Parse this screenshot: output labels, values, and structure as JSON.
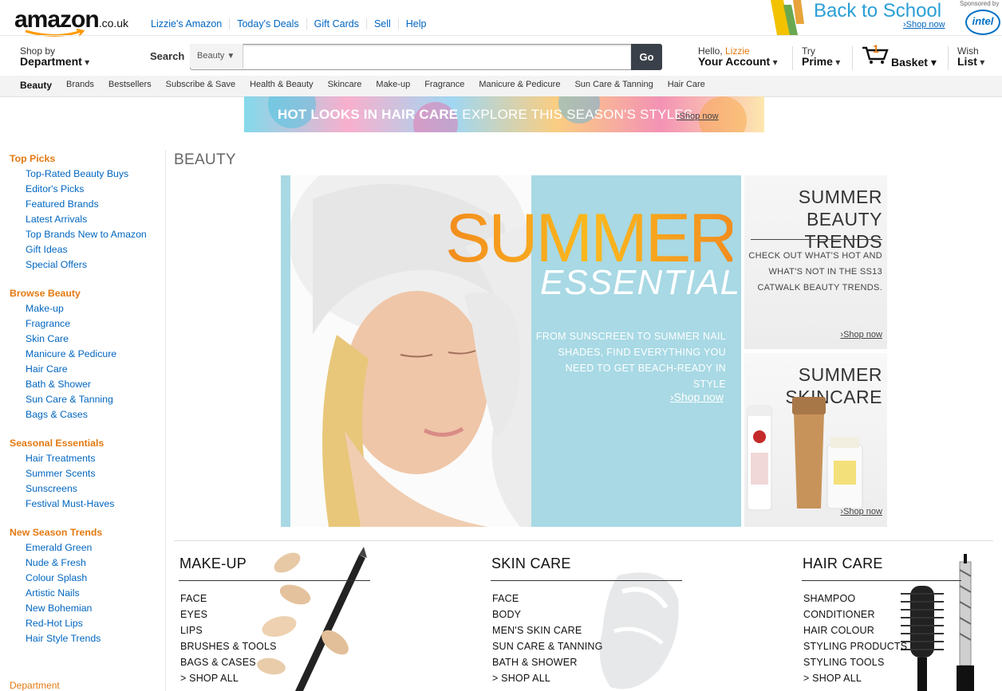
{
  "header": {
    "logo_text": "amazon",
    "logo_tld": ".co.uk",
    "top_links": [
      "Lizzie's Amazon",
      "Today's Deals",
      "Gift Cards",
      "Sell",
      "Help"
    ],
    "promo": {
      "title": "Back to School",
      "shop_now": "Shop now",
      "sponsored": "Sponsored by",
      "sponsor": "intel"
    },
    "shop_by": "Shop by",
    "department": "Department",
    "search_label": "Search",
    "search_category": "Beauty",
    "search_value": "",
    "go_label": "Go",
    "hello": "Hello, ",
    "user_name": "Lizzie",
    "your_account": "Your Account",
    "try": "Try",
    "prime": "Prime",
    "basket_count": "1",
    "basket": "Basket",
    "wish": "Wish",
    "list": "List"
  },
  "subnav": [
    "Beauty",
    "Brands",
    "Bestsellers",
    "Subscribe & Save",
    "Health & Beauty",
    "Skincare",
    "Make-up",
    "Fragrance",
    "Manicure & Pedicure",
    "Sun Care & Tanning",
    "Hair Care"
  ],
  "hair_banner": {
    "bold": "HOT LOOKS IN HAIR CARE",
    "light": "EXPLORE THIS SEASON'S STYLES",
    "shop_now": "Shop now"
  },
  "leftnav": [
    {
      "heading": "Top Picks",
      "items": [
        "Top-Rated Beauty Buys",
        "Editor's Picks",
        "Featured Brands",
        "Latest Arrivals",
        "Top Brands New to Amazon",
        "Gift Ideas",
        "Special Offers"
      ]
    },
    {
      "heading": "Browse Beauty",
      "items": [
        "Make-up",
        "Fragrance",
        "Skin Care",
        "Manicure & Pedicure",
        "Hair Care",
        "Bath & Shower",
        "Sun Care & Tanning",
        "Bags & Cases"
      ]
    },
    {
      "heading": "Seasonal Essentials",
      "items": [
        "Hair Treatments",
        "Summer Scents",
        "Sunscreens",
        "Festival Must-Haves"
      ]
    },
    {
      "heading": "New Season Trends",
      "items": [
        "Emerald Green",
        "Nude & Fresh",
        "Colour Splash",
        "Artistic Nails",
        "New Bohemian",
        "Red-Hot Lips",
        "Hair Style Trends"
      ]
    }
  ],
  "leftnav_bottom": "Department",
  "main": {
    "title": "BEAUTY",
    "hero": {
      "summer": "SUMMER",
      "essentials": "ESSENTIALS",
      "body": "FROM SUNSCREEN TO SUMMER NAIL SHADES, FIND EVERYTHING YOU NEED TO GET BEACH-READY IN STYLE",
      "shop_now": "Shop now"
    },
    "card1": {
      "title_line1": "SUMMER",
      "title_line2": "BEAUTY TRENDS",
      "body": "CHECK OUT WHAT'S HOT AND WHAT'S NOT IN THE SS13 CATWALK BEAUTY TRENDS.",
      "shop_now": "Shop now"
    },
    "card2": {
      "title_line1": "SUMMER",
      "title_line2": "SKINCARE",
      "shop_now": "Shop now"
    },
    "categories": [
      {
        "title": "MAKE-UP",
        "items": [
          "FACE",
          "EYES",
          "LIPS",
          "BRUSHES & TOOLS",
          "BAGS & CASES",
          "> SHOP ALL"
        ]
      },
      {
        "title": "SKIN CARE",
        "items": [
          "FACE",
          "BODY",
          "MEN'S SKIN CARE",
          "SUN CARE & TANNING",
          "BATH & SHOWER",
          "> SHOP ALL"
        ]
      },
      {
        "title": "HAIR CARE",
        "items": [
          "SHAMPOO",
          "CONDITIONER",
          "HAIR COLOUR",
          "STYLING PRODUCTS",
          "STYLING TOOLS",
          "> SHOP ALL"
        ]
      }
    ]
  },
  "colors": {
    "link": "#0066c0",
    "accent_orange": "#e47911",
    "hero_blue": "#a8d9e4",
    "go_button": "#3a4049"
  }
}
